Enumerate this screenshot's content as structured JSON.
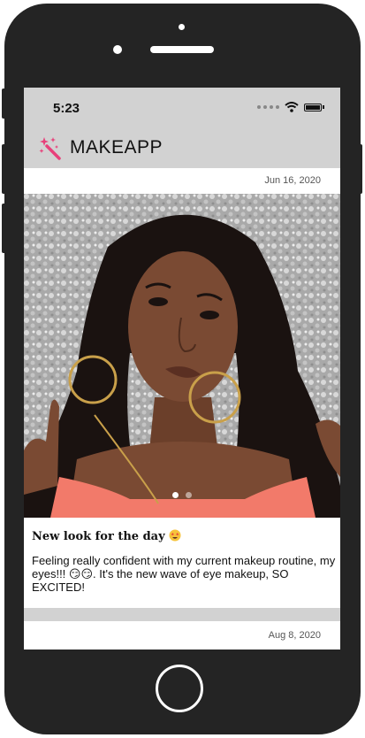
{
  "status_bar": {
    "time": "5:23"
  },
  "app": {
    "title": "MAKEAPP",
    "logo_icon": "sparkle-wand-icon"
  },
  "posts": [
    {
      "date": "Jun 16, 2020",
      "title": "New look for the day",
      "title_emoji": "star-struck-emoji",
      "text": "Feeling really confident with my current makeup routine, my eyes!!! 😏😏. It's the new wave of eye makeup, SO EXCITED!",
      "carousel": {
        "count": 2,
        "active_index": 0
      }
    },
    {
      "date": "Aug 8, 2020"
    }
  ],
  "colors": {
    "frame": "#242424",
    "header_bg": "#d2d2d2",
    "logo_accent": "#e8407a",
    "top_color": "#f27a6a"
  }
}
